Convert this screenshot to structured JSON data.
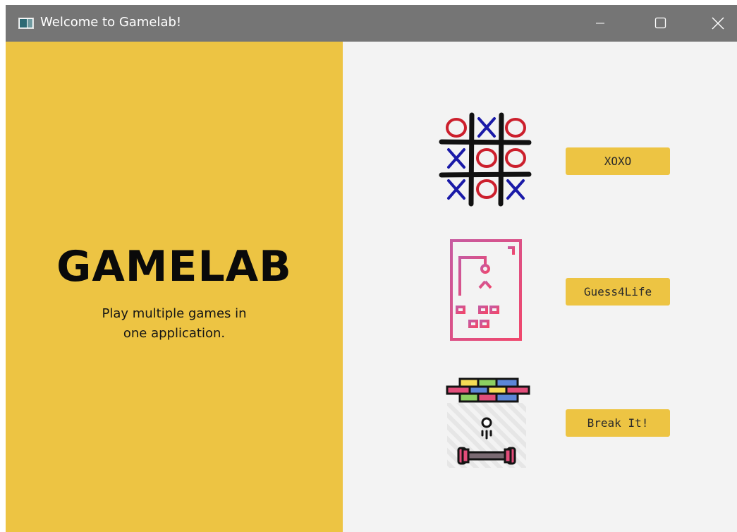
{
  "window": {
    "title": "Welcome to Gamelab!",
    "icon": "app-window-icon",
    "controls": [
      "minimize-icon",
      "maximize-icon",
      "close-icon"
    ]
  },
  "hero": {
    "logo": "GAMELAB",
    "tagline_line1": "Play multiple games in",
    "tagline_line2": "one application."
  },
  "games": [
    {
      "icon": "tic-tac-toe-icon",
      "label": "XOXO"
    },
    {
      "icon": "hangman-icon",
      "label": "Guess4Life"
    },
    {
      "icon": "brick-breaker-icon",
      "label": "Break It!"
    }
  ],
  "colors": {
    "accent": "#edc443",
    "titlebar": "#757575",
    "background": "#f3f3f3",
    "x_mark": "#1a1aa8",
    "o_mark": "#cc1f2c"
  }
}
